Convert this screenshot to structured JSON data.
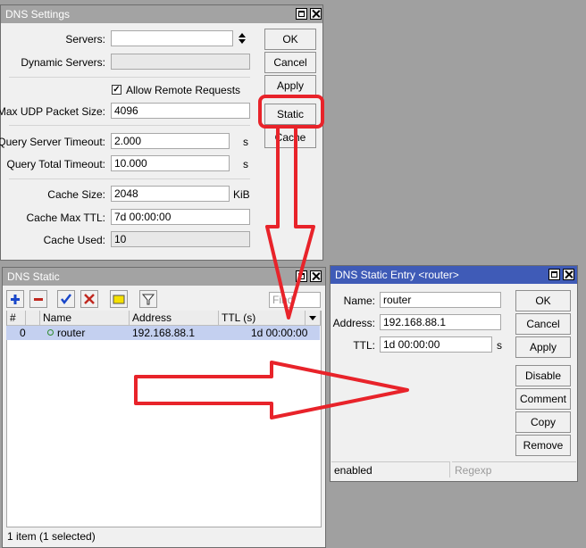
{
  "dns_settings": {
    "title": "DNS Settings",
    "servers_label": "Servers:",
    "servers_value": "",
    "dynamic_servers_label": "Dynamic Servers:",
    "dynamic_servers_value": "",
    "allow_remote_label": "Allow Remote Requests",
    "allow_remote_checked": true,
    "max_udp_label": "Max UDP Packet Size:",
    "max_udp_value": "4096",
    "query_server_timeout_label": "Query Server Timeout:",
    "query_server_timeout_value": "2.000",
    "query_total_timeout_label": "Query Total Timeout:",
    "query_total_timeout_value": "10.000",
    "seconds_unit": "s",
    "cache_size_label": "Cache Size:",
    "cache_size_value": "2048",
    "cache_size_unit": "KiB",
    "cache_max_ttl_label": "Cache Max TTL:",
    "cache_max_ttl_value": "7d 00:00:00",
    "cache_used_label": "Cache Used:",
    "cache_used_value": "10",
    "buttons": {
      "ok": "OK",
      "cancel": "Cancel",
      "apply": "Apply",
      "static": "Static",
      "cache": "Cache"
    }
  },
  "dns_static": {
    "title": "DNS Static",
    "find_placeholder": "Find",
    "columns": {
      "hash": "#",
      "name": "Name",
      "address": "Address",
      "ttl": "TTL (s)"
    },
    "rows": [
      {
        "index": "0",
        "name": "router",
        "address": "192.168.88.1",
        "ttl": "1d 00:00:00",
        "selected": true
      }
    ],
    "status": "1 item (1 selected)"
  },
  "static_entry": {
    "title": "DNS Static Entry <router>",
    "name_label": "Name:",
    "name_value": "router",
    "address_label": "Address:",
    "address_value": "192.168.88.1",
    "ttl_label": "TTL:",
    "ttl_value": "1d 00:00:00",
    "ttl_unit": "s",
    "buttons": {
      "ok": "OK",
      "cancel": "Cancel",
      "apply": "Apply",
      "disable": "Disable",
      "comment": "Comment",
      "copy": "Copy",
      "remove": "Remove"
    },
    "status_enabled": "enabled",
    "status_regexp": "Regexp"
  },
  "annotation_color": "#e8232a"
}
